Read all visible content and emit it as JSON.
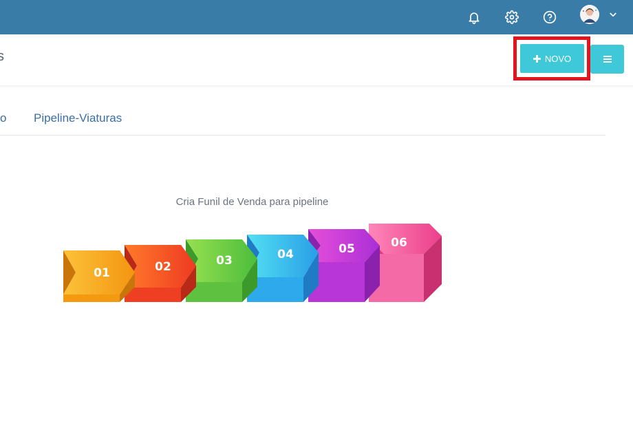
{
  "header": {
    "title_fragment": "s"
  },
  "actions": {
    "new_label": "NOVO"
  },
  "tabs": [
    {
      "label": "o"
    },
    {
      "label": "Pipeline-Viaturas"
    }
  ],
  "empty_state": {
    "caption": "Cria Funil de Venda para pipeline",
    "steps": [
      "01",
      "02",
      "03",
      "04",
      "05",
      "06"
    ]
  },
  "icons": {
    "notifications": "bell-icon",
    "settings": "gear-icon",
    "help": "help-icon",
    "user_menu": "chevron-down-icon",
    "new": "plus-icon",
    "menu": "hamburger-icon"
  },
  "colors": {
    "topbar": "#3a7ca8",
    "accent": "#3fc9d8",
    "highlight": "#e3141b",
    "tab_text": "#3a6ea5",
    "step_01": "#f7a21b",
    "step_02": "#f2502a",
    "step_03": "#6ccc45",
    "step_04": "#32b9ea",
    "step_05": "#c23ed9",
    "step_06": "#f0549b"
  }
}
